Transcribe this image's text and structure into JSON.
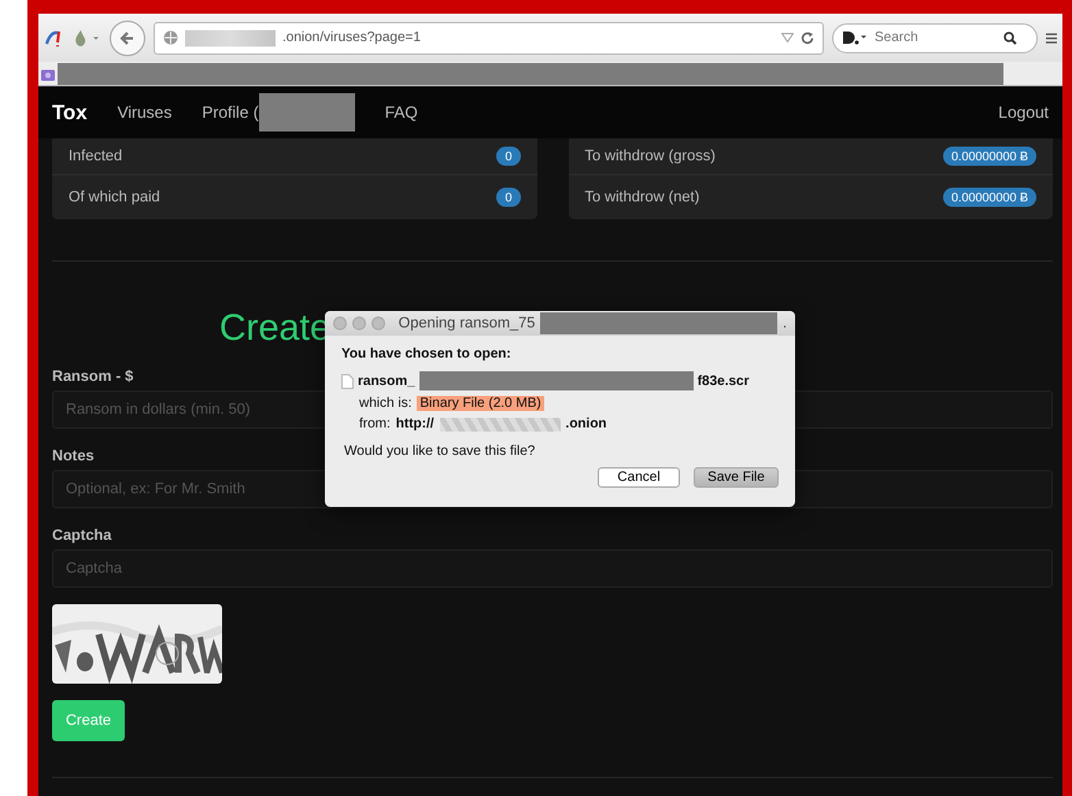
{
  "browser": {
    "url": ".onion/viruses?page=1",
    "search": {
      "placeholder": "Search"
    }
  },
  "navbar": {
    "brand": "Tox",
    "items": [
      {
        "label": "Viruses",
        "redacted": false
      },
      {
        "label": "Profile (",
        "redacted": true
      },
      {
        "label": "FAQ",
        "redacted": false
      }
    ],
    "logout": "Logout"
  },
  "stats": [
    [
      {
        "label": "Infected",
        "value": "0"
      },
      {
        "label": "Of which paid",
        "value": "0"
      }
    ],
    [
      {
        "label": "To withdrow (gross)",
        "value": "0.00000000 Ƀ"
      },
      {
        "label": "To withdrow (net)",
        "value": "0.00000000 Ƀ"
      }
    ]
  ],
  "form": {
    "heading": "Create",
    "fields": [
      {
        "label": "Ransom - $",
        "placeholder": "Ransom in dollars (min. 50)"
      },
      {
        "label": "Notes",
        "placeholder": "Optional, ex: For Mr. Smith"
      },
      {
        "label": "Captcha",
        "placeholder": "Captcha"
      }
    ],
    "submit": "Create"
  },
  "dialog": {
    "title": "Opening ransom_75",
    "title_end": ".",
    "heading": "You have chosen to open:",
    "file_name_start": "ransom_",
    "file_name_end": "f83e.scr",
    "type_label": "which is:",
    "type_value": "Binary File (2.0 MB)",
    "from_label": "from:",
    "from_start": "http://",
    "from_end": ".onion",
    "question": "Would you like to save this file?",
    "buttons": [
      {
        "label": "Cancel",
        "selected": false
      },
      {
        "label": "Save File",
        "selected": true
      }
    ]
  }
}
